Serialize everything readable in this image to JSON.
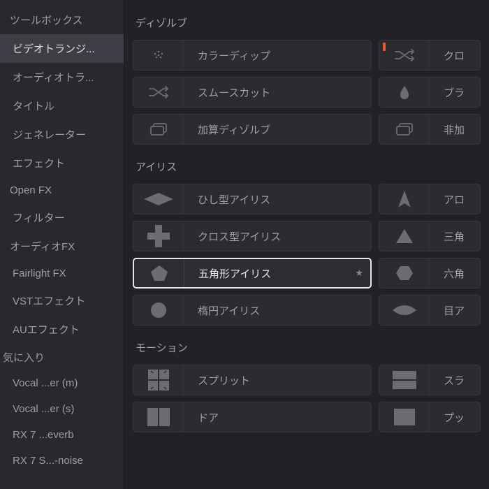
{
  "sidebar": {
    "items": [
      {
        "label": "ツールボックス",
        "level": 0,
        "selected": false
      },
      {
        "label": "ビデオトランジ...",
        "level": 1,
        "selected": true
      },
      {
        "label": "オーディオトラ...",
        "level": 1,
        "selected": false
      },
      {
        "label": "タイトル",
        "level": 1,
        "selected": false
      },
      {
        "label": "ジェネレーター",
        "level": 1,
        "selected": false
      },
      {
        "label": "エフェクト",
        "level": 1,
        "selected": false
      },
      {
        "label": "Open FX",
        "level": 0,
        "selected": false
      },
      {
        "label": "フィルター",
        "level": 1,
        "selected": false
      },
      {
        "label": "オーディオFX",
        "level": 0,
        "selected": false
      },
      {
        "label": "Fairlight FX",
        "level": 1,
        "selected": false
      },
      {
        "label": "VSTエフェクト",
        "level": 1,
        "selected": false
      },
      {
        "label": "AUエフェクト",
        "level": 1,
        "selected": false
      }
    ],
    "favorites_header": "気に入り",
    "favorites": [
      {
        "label": "Vocal ...er (m)"
      },
      {
        "label": "Vocal ...er (s)"
      },
      {
        "label": "RX 7 ...everb"
      },
      {
        "label": "RX 7 S...-noise"
      }
    ]
  },
  "sections": [
    {
      "title": "ディゾルブ",
      "rows": [
        {
          "l": {
            "icon": "dots",
            "label": "カラーディップ"
          },
          "r": {
            "icon": "shuffle",
            "label": "クロ",
            "flag": "orange"
          }
        },
        {
          "l": {
            "icon": "shuffle",
            "label": "スムースカット"
          },
          "r": {
            "icon": "drop",
            "label": "ブラ"
          }
        },
        {
          "l": {
            "icon": "stack",
            "label": "加算ディゾルブ"
          },
          "r": {
            "icon": "stack",
            "label": "非加"
          }
        }
      ]
    },
    {
      "title": "アイリス",
      "rows": [
        {
          "l": {
            "icon": "diamond",
            "label": "ひし型アイリス"
          },
          "r": {
            "icon": "arrowhead",
            "label": "アロ"
          }
        },
        {
          "l": {
            "icon": "plus",
            "label": "クロス型アイリス"
          },
          "r": {
            "icon": "triangle",
            "label": "三角"
          }
        },
        {
          "l": {
            "icon": "pentagon",
            "label": "五角形アイリス",
            "selected": true,
            "star": true
          },
          "r": {
            "icon": "hexagon",
            "label": "六角"
          }
        },
        {
          "l": {
            "icon": "circle",
            "label": "楕円アイリス"
          },
          "r": {
            "icon": "eye",
            "label": "目ア"
          }
        }
      ]
    },
    {
      "title": "モーション",
      "rows": [
        {
          "l": {
            "icon": "split",
            "label": "スプリット"
          },
          "r": {
            "icon": "slide",
            "label": "スラ"
          }
        },
        {
          "l": {
            "icon": "door",
            "label": "ドア"
          },
          "r": {
            "icon": "push",
            "label": "プッ"
          }
        }
      ]
    }
  ]
}
